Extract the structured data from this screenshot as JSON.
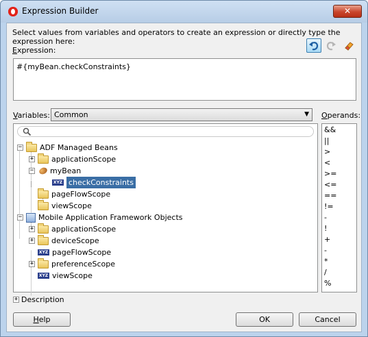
{
  "window": {
    "title": "Expression Builder",
    "close_glyph": "✕"
  },
  "instructions": "Select values from variables and operators to create an expression or directly type the expression here:",
  "expression": {
    "label_mnemonic": "E",
    "label_rest": "xpression:",
    "value": "#{myBean.checkConstraints}"
  },
  "toolbar": {
    "undo_icon": "undo-icon",
    "redo_icon": "redo-icon",
    "clear_icon": "eraser-icon"
  },
  "variables": {
    "label_mnemonic": "V",
    "label_rest": "ariables:",
    "selected": "Common"
  },
  "operands": {
    "label_mnemonic": "O",
    "label_rest": "perands:",
    "items": [
      "&&",
      "||",
      ">",
      "<",
      ">=",
      "<=",
      "==",
      "!=",
      "-",
      "!",
      "+",
      "-",
      "*",
      "/",
      "%"
    ]
  },
  "tree": {
    "items": [
      {
        "label": "ADF Managed Beans",
        "icon": "folder-icon",
        "toggle": "−"
      },
      {
        "label": "applicationScope",
        "icon": "folder-icon",
        "toggle": "+"
      },
      {
        "label": "myBean",
        "icon": "bean-icon",
        "toggle": "−"
      },
      {
        "label": "checkConstraints",
        "icon": "xyz-icon",
        "xyz": "XYZ"
      },
      {
        "label": "pageFlowScope",
        "icon": "folder-icon"
      },
      {
        "label": "viewScope",
        "icon": "folder-icon"
      },
      {
        "label": "Mobile Application Framework Objects",
        "icon": "maf-objects-icon",
        "toggle": "−"
      },
      {
        "label": "applicationScope",
        "icon": "folder-icon",
        "toggle": "+"
      },
      {
        "label": "deviceScope",
        "icon": "folder-icon",
        "toggle": "+"
      },
      {
        "label": "pageFlowScope",
        "icon": "xyz-icon",
        "xyz": "XYZ"
      },
      {
        "label": "preferenceScope",
        "icon": "folder-icon",
        "toggle": "+"
      },
      {
        "label": "viewScope",
        "icon": "xyz-icon",
        "xyz": "XYZ"
      }
    ]
  },
  "description": {
    "label": "Description",
    "toggle": "+"
  },
  "buttons": {
    "help_mnemonic": "H",
    "help_rest": "elp",
    "ok": "OK",
    "cancel": "Cancel"
  }
}
